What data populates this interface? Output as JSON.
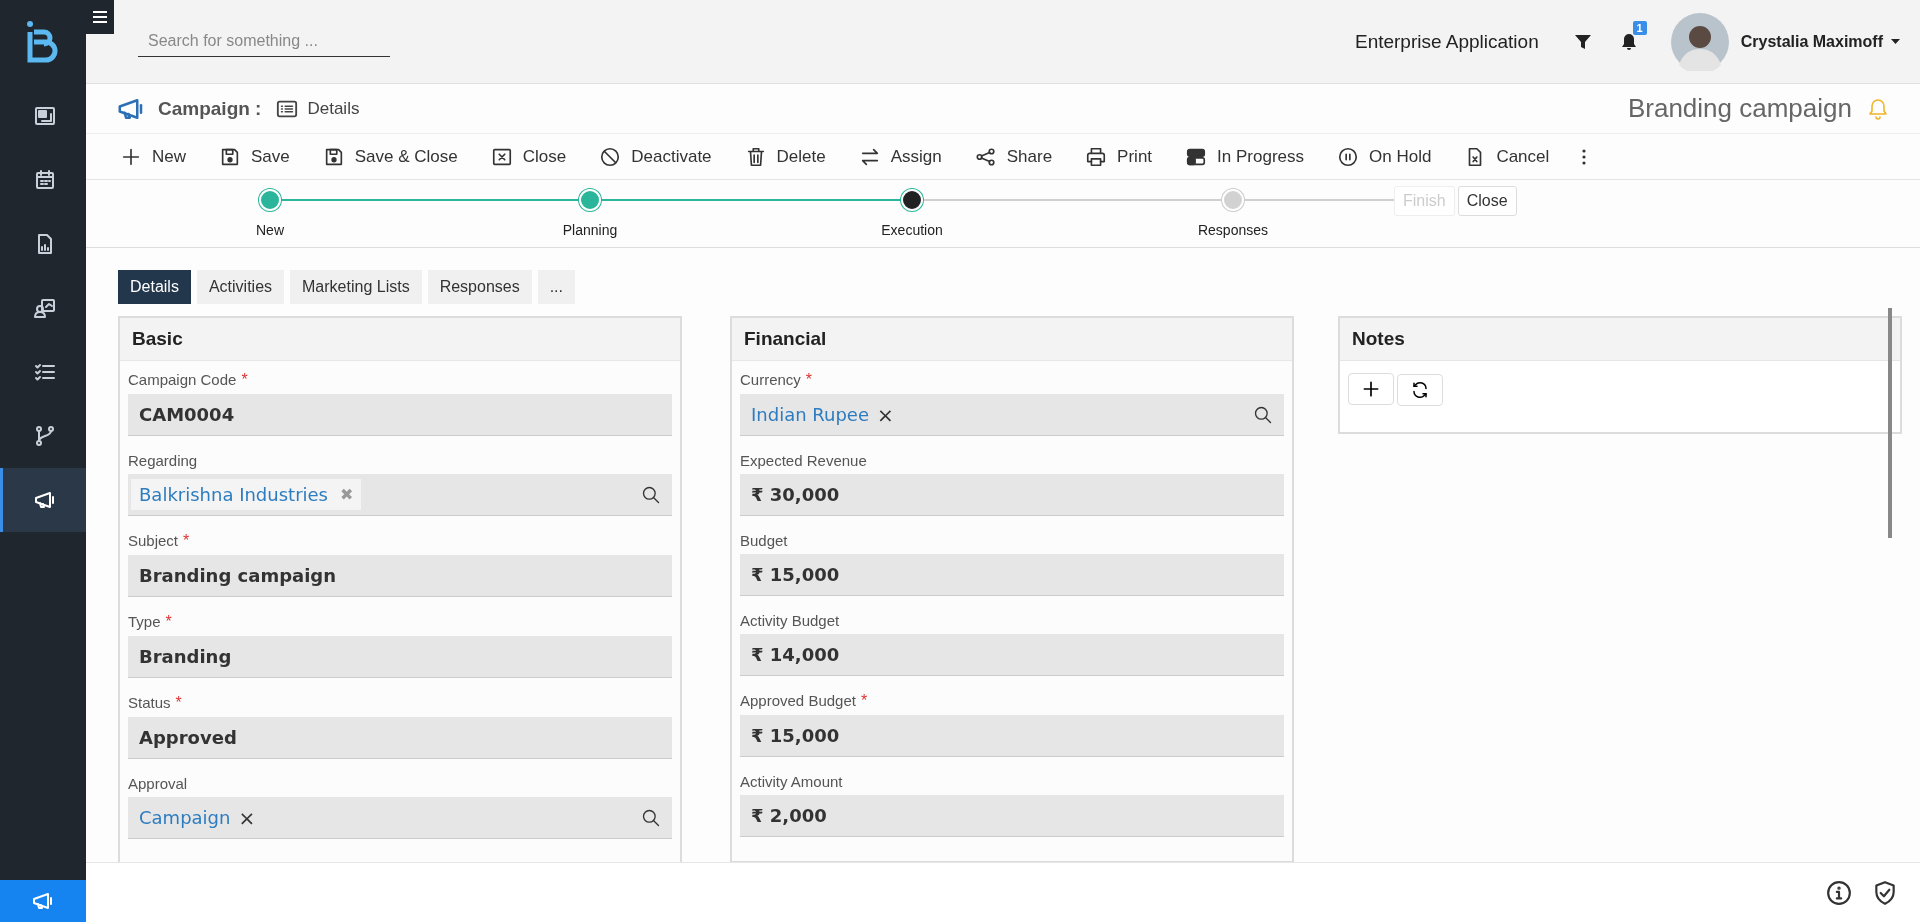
{
  "topbar": {
    "search": {
      "placeholder": "Search for something ..."
    },
    "app_name": "Enterprise Application",
    "notification_count": "1",
    "user": {
      "name": "Crystalia Maximoff"
    }
  },
  "sidebar": {
    "items": [
      {
        "selected": false
      },
      {
        "selected": false
      },
      {
        "selected": false
      },
      {
        "selected": false
      },
      {
        "selected": false
      },
      {
        "selected": false
      },
      {
        "selected": true
      }
    ]
  },
  "header": {
    "entity": "Campaign :",
    "view": "Details",
    "record_title": "Branding campaign"
  },
  "toolbar": [
    {
      "label": "New"
    },
    {
      "label": "Save"
    },
    {
      "label": "Save & Close"
    },
    {
      "label": "Close"
    },
    {
      "label": "Deactivate"
    },
    {
      "label": "Delete"
    },
    {
      "label": "Assign"
    },
    {
      "label": "Share"
    },
    {
      "label": "Print"
    },
    {
      "label": "In Progress"
    },
    {
      "label": "On Hold"
    },
    {
      "label": "Cancel"
    }
  ],
  "process": {
    "stages": [
      {
        "label": "New",
        "done": true,
        "selected": false
      },
      {
        "label": "Planning",
        "done": true,
        "selected": false
      },
      {
        "label": "Execution",
        "done": false,
        "selected": true
      },
      {
        "label": "Responses",
        "done": false,
        "selected": false
      }
    ],
    "buttons": [
      {
        "label": "Finish",
        "disabled": true
      },
      {
        "label": "Close",
        "disabled": false
      }
    ]
  },
  "tabs": [
    {
      "label": "Details",
      "selected": true
    },
    {
      "label": "Activities",
      "selected": false
    },
    {
      "label": "Marketing Lists",
      "selected": false
    },
    {
      "label": "Responses",
      "selected": false
    },
    {
      "label": "...",
      "selected": false
    }
  ],
  "sections": [
    {
      "title": "Basic",
      "fields": [
        {
          "label": "Campaign Code",
          "marker": "*",
          "kind": "text",
          "value": "CAM0004"
        },
        {
          "label": "Regarding",
          "kind": "tag",
          "value": "Balkrishna Industries",
          "remove": "✖"
        },
        {
          "label": "Subject",
          "marker": "*",
          "kind": "text",
          "value": "Branding campaign"
        },
        {
          "label": "Type",
          "marker": "*",
          "kind": "text",
          "value": "Branding"
        },
        {
          "label": "Status",
          "marker": "*",
          "kind": "text",
          "value": "Approved"
        },
        {
          "label": "Approval",
          "kind": "lookup",
          "value": "Campaign",
          "remove": "×"
        }
      ]
    },
    {
      "title": "Financial",
      "fields": [
        {
          "label": "Currency",
          "marker": "*",
          "kind": "lookup",
          "value": "Indian Rupee",
          "remove": "×"
        },
        {
          "label": "Expected Revenue",
          "kind": "text",
          "value": "₹ 30,000"
        },
        {
          "label": "Budget",
          "kind": "text",
          "value": "₹ 15,000"
        },
        {
          "label": "Activity Budget",
          "kind": "text",
          "value": "₹ 14,000"
        },
        {
          "label": "Approved Budget",
          "marker": "*",
          "kind": "text",
          "value": "₹ 15,000"
        },
        {
          "label": "Activity Amount",
          "kind": "text",
          "value": "₹ 2,000"
        }
      ]
    }
  ],
  "notes": {
    "title": "Notes"
  }
}
